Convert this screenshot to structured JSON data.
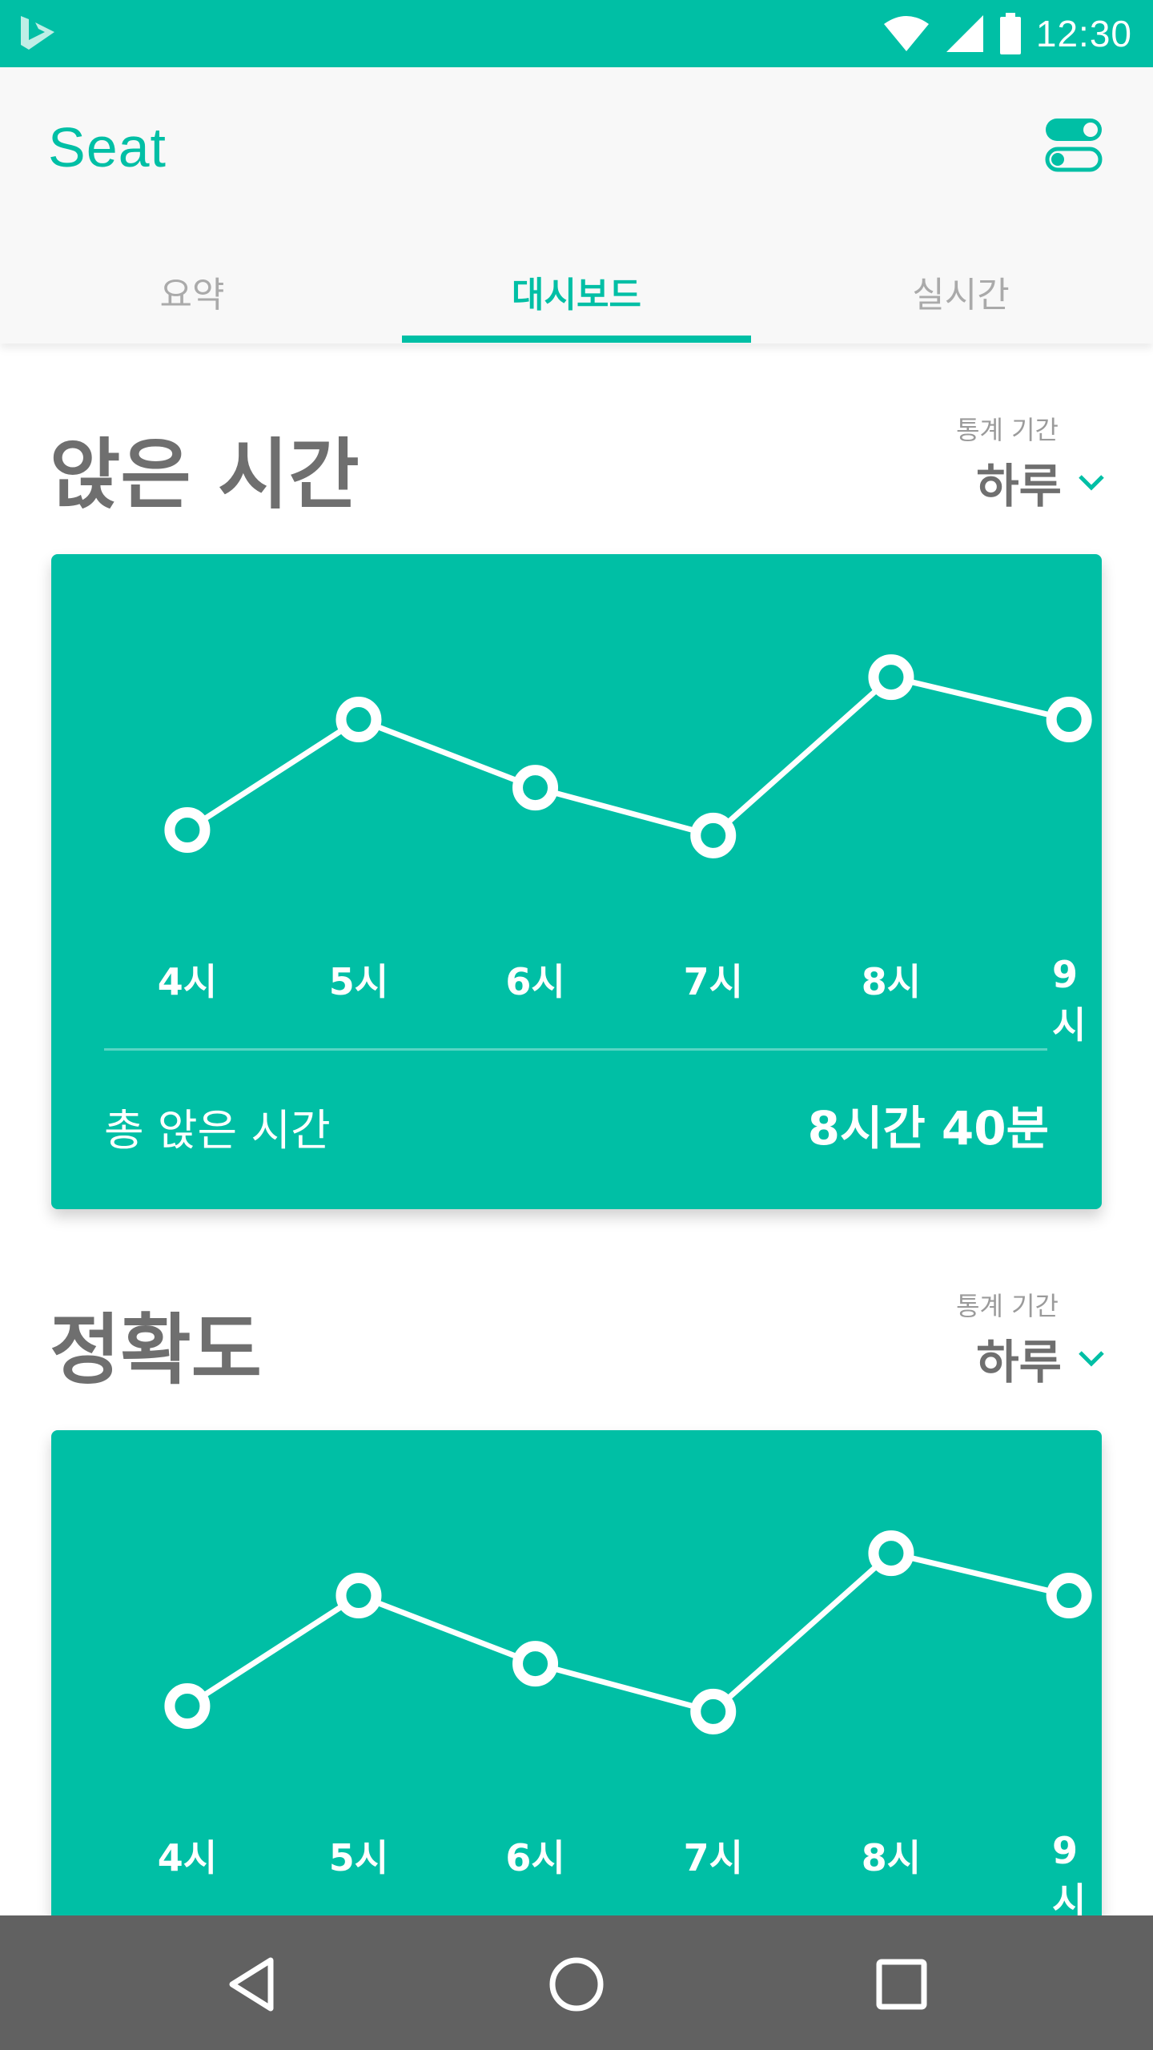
{
  "status_bar": {
    "time": "12:30",
    "color": "#00bfa5"
  },
  "app": {
    "title": "Seat",
    "toggle_icon": "toggle-icon"
  },
  "tabs": [
    {
      "label": "요약",
      "active": false
    },
    {
      "label": "대시보드",
      "active": true
    },
    {
      "label": "실시간",
      "active": false
    }
  ],
  "sections": [
    {
      "title": "앉은 시간",
      "period_label": "통계 기간",
      "period_value": "하루",
      "total_label": "총 앉은 시간",
      "total_value": "8시간 40분"
    },
    {
      "title": "정확도",
      "period_label": "통계 기간",
      "period_value": "하루"
    }
  ],
  "chart_data": [
    {
      "type": "line",
      "categories": [
        "4시",
        "5시",
        "6시",
        "7시",
        "8시",
        "9시"
      ],
      "values": [
        0.15,
        0.75,
        0.38,
        0.12,
        0.98,
        0.75
      ],
      "color": "#ffffff"
    },
    {
      "type": "line",
      "categories": [
        "4시",
        "5시",
        "6시",
        "7시",
        "8시",
        "9시"
      ],
      "values": [
        0.15,
        0.75,
        0.38,
        0.12,
        0.98,
        0.75
      ],
      "color": "#ffffff"
    }
  ],
  "nav": {
    "back": "back-icon",
    "home": "home-icon",
    "recents": "recents-icon"
  },
  "colors": {
    "accent": "#00bfa5",
    "heading": "#6f6f6f",
    "muted": "#aaaaaa",
    "nav": "#616161"
  }
}
